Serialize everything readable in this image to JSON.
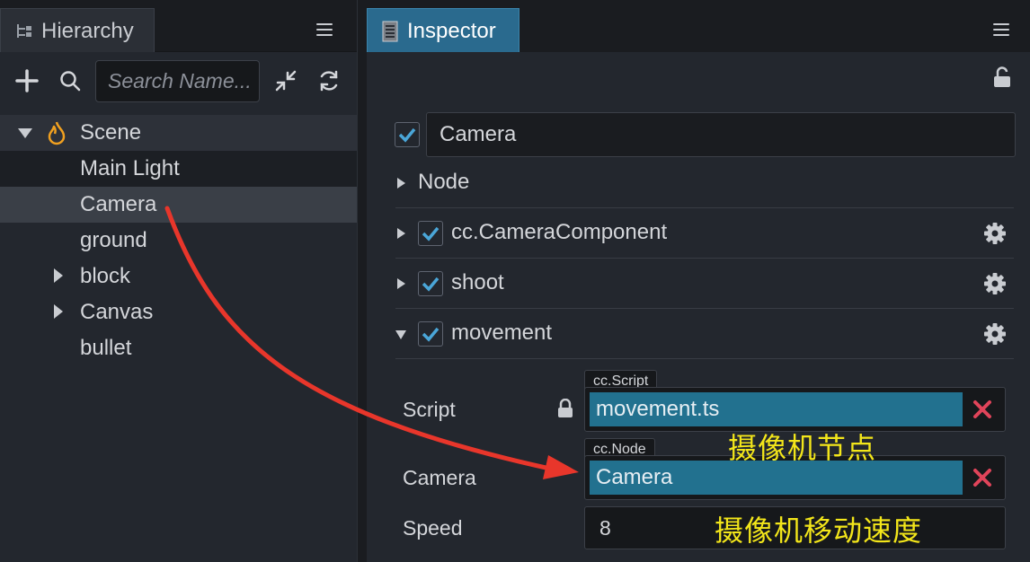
{
  "hierarchy": {
    "tab_label": "Hierarchy",
    "search_placeholder": "Search Name...",
    "tree": [
      {
        "label": "Scene",
        "expanded": true,
        "icon": "scene-flame-icon"
      },
      {
        "label": "Main Light"
      },
      {
        "label": "Camera",
        "selected": true
      },
      {
        "label": "ground"
      },
      {
        "label": "block",
        "collapsed": true
      },
      {
        "label": "Canvas",
        "collapsed": true
      },
      {
        "label": "bullet"
      }
    ]
  },
  "inspector": {
    "tab_label": "Inspector",
    "node_name": "Camera",
    "node_active": true,
    "sections": [
      {
        "label": "Node",
        "has_checkbox": false,
        "expanded": false
      },
      {
        "label": "cc.CameraComponent",
        "has_checkbox": true,
        "checked": true,
        "expanded": false
      },
      {
        "label": "shoot",
        "has_checkbox": true,
        "checked": true,
        "expanded": false
      },
      {
        "label": "movement",
        "has_checkbox": true,
        "checked": true,
        "expanded": true
      }
    ],
    "movement_props": {
      "script": {
        "label": "Script",
        "type_tag": "cc.Script",
        "value": "movement.ts"
      },
      "camera": {
        "label": "Camera",
        "type_tag": "cc.Node",
        "value": "Camera"
      },
      "speed": {
        "label": "Speed",
        "value": "8"
      }
    }
  },
  "annotations": {
    "camera_node": "摄像机节点",
    "camera_speed": "摄像机移动速度"
  },
  "colors": {
    "selected_row": "#3a3f47",
    "accent_tab": "#2a6a8e",
    "ref_value_bg": "#22718f",
    "clear_x": "#e0445a",
    "checkbox_check": "#4aa6d8",
    "annotation_text": "#f3e61a",
    "arrow": "#e8362b"
  }
}
